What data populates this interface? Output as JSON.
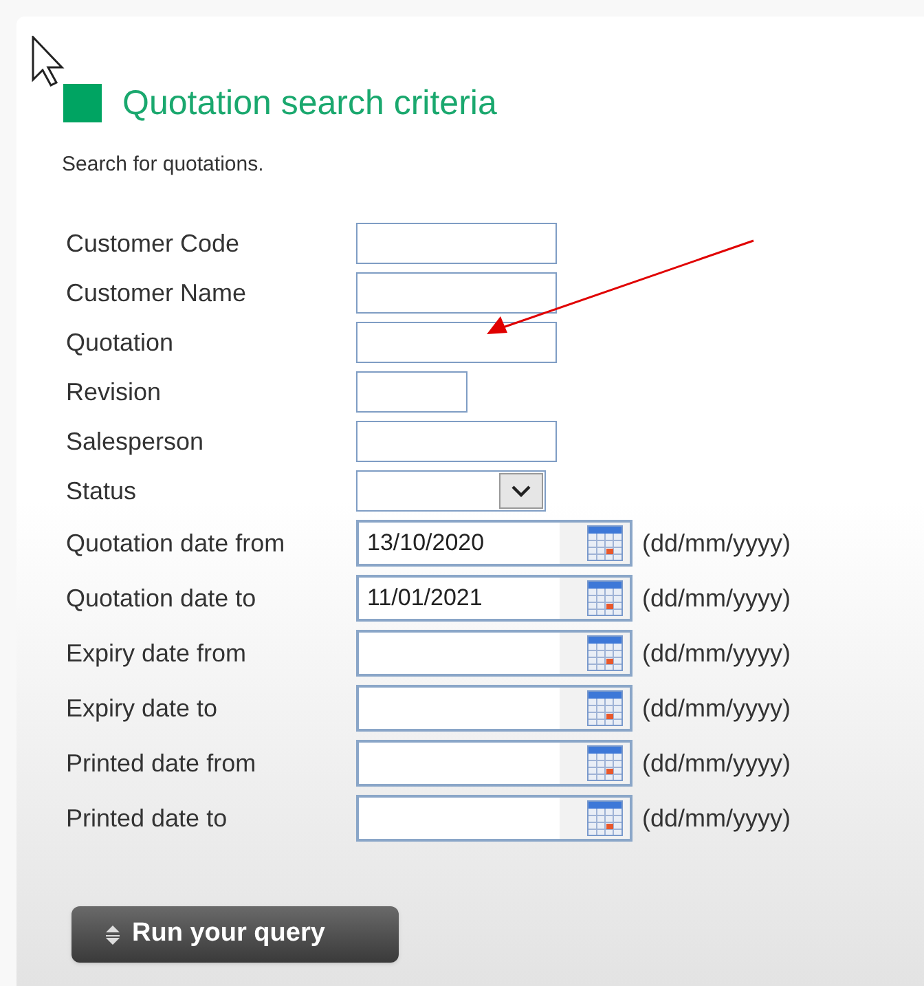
{
  "header": {
    "title": "Quotation search criteria",
    "subtitle": "Search for quotations."
  },
  "fields": [
    {
      "label": "Customer Code",
      "kind": "text"
    },
    {
      "label": "Customer Name",
      "kind": "text"
    },
    {
      "label": "Quotation",
      "kind": "text"
    },
    {
      "label": "Revision",
      "kind": "short"
    },
    {
      "label": "Salesperson",
      "kind": "text"
    },
    {
      "label": "Status",
      "kind": "select"
    },
    {
      "label": "Quotation date from",
      "kind": "date",
      "value": "13/10/2020",
      "hint": "(dd/mm/yyyy)"
    },
    {
      "label": "Quotation date to",
      "kind": "date",
      "value": "11/01/2021",
      "hint": "(dd/mm/yyyy)"
    },
    {
      "label": "Expiry date from",
      "kind": "date",
      "hint": "(dd/mm/yyyy)"
    },
    {
      "label": "Expiry date to",
      "kind": "date",
      "hint": "(dd/mm/yyyy)"
    },
    {
      "label": "Printed date from",
      "kind": "date",
      "hint": "(dd/mm/yyyy)"
    },
    {
      "label": "Printed date to",
      "kind": "date",
      "hint": "(dd/mm/yyyy)"
    }
  ],
  "run_button": {
    "label": "Run your query"
  }
}
